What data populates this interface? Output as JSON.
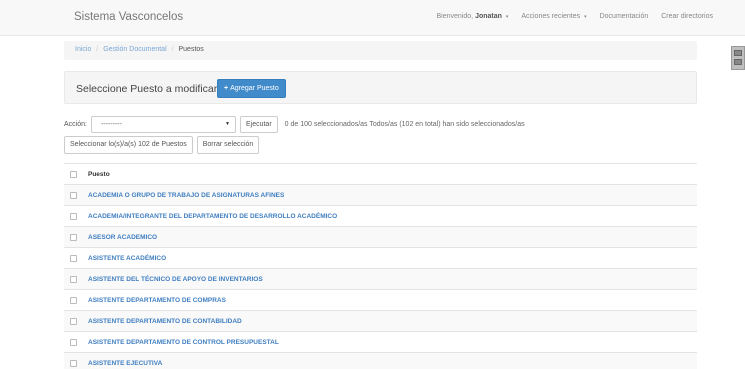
{
  "navbar": {
    "brand": "Sistema Vasconcelos",
    "welcome_prefix": "Bienvenido,",
    "user": "Jonatan",
    "caret": "▾",
    "recent_actions": "Acciones recientes",
    "documentation": "Documentación",
    "create_directories": "Crear directorios"
  },
  "breadcrumb": {
    "items": [
      "Inicio",
      "Gestión Documental",
      "Puestos"
    ],
    "separator": "/"
  },
  "panel": {
    "title": "Seleccione Puesto a modificar",
    "add_icon": "+",
    "add_button": "Agregar Puesto"
  },
  "actions": {
    "label": "Acción:",
    "select_value": "---------",
    "select_arrow": "▼",
    "execute": "Ejecutar",
    "counter": "0 de 100 seleccionados/as Todos/as (102 en total) han sido seleccionados/as",
    "select_all": "Seleccionar lo(s)/a(s) 102 de Puestos",
    "clear_selection": "Borrar selección"
  },
  "table": {
    "header": "Puesto",
    "rows": [
      "ACADEMIA O GRUPO DE TRABAJO DE ASIGNATURAS AFINES",
      "ACADEMIA/INTEGRANTE DEL DEPARTAMENTO DE DESARROLLO ACADÉMICO",
      "ASESOR ACADEMICO",
      "ASISTENTE ACADÉMICO",
      "ASISTENTE DEL TÉCNICO DE APOYO DE INVENTARIOS",
      "ASISTENTE DEPARTAMENTO DE COMPRAS",
      "ASISTENTE DEPARTAMENTO DE CONTABILIDAD",
      "ASISTENTE DEPARTAMENTO DE CONTROL PRESUPUESTAL",
      "ASISTENTE EJECUTIVA"
    ]
  },
  "colors": {
    "link": "#3f7ec0",
    "primary": "#428bca",
    "navbar_bg": "#f8f8f8"
  }
}
